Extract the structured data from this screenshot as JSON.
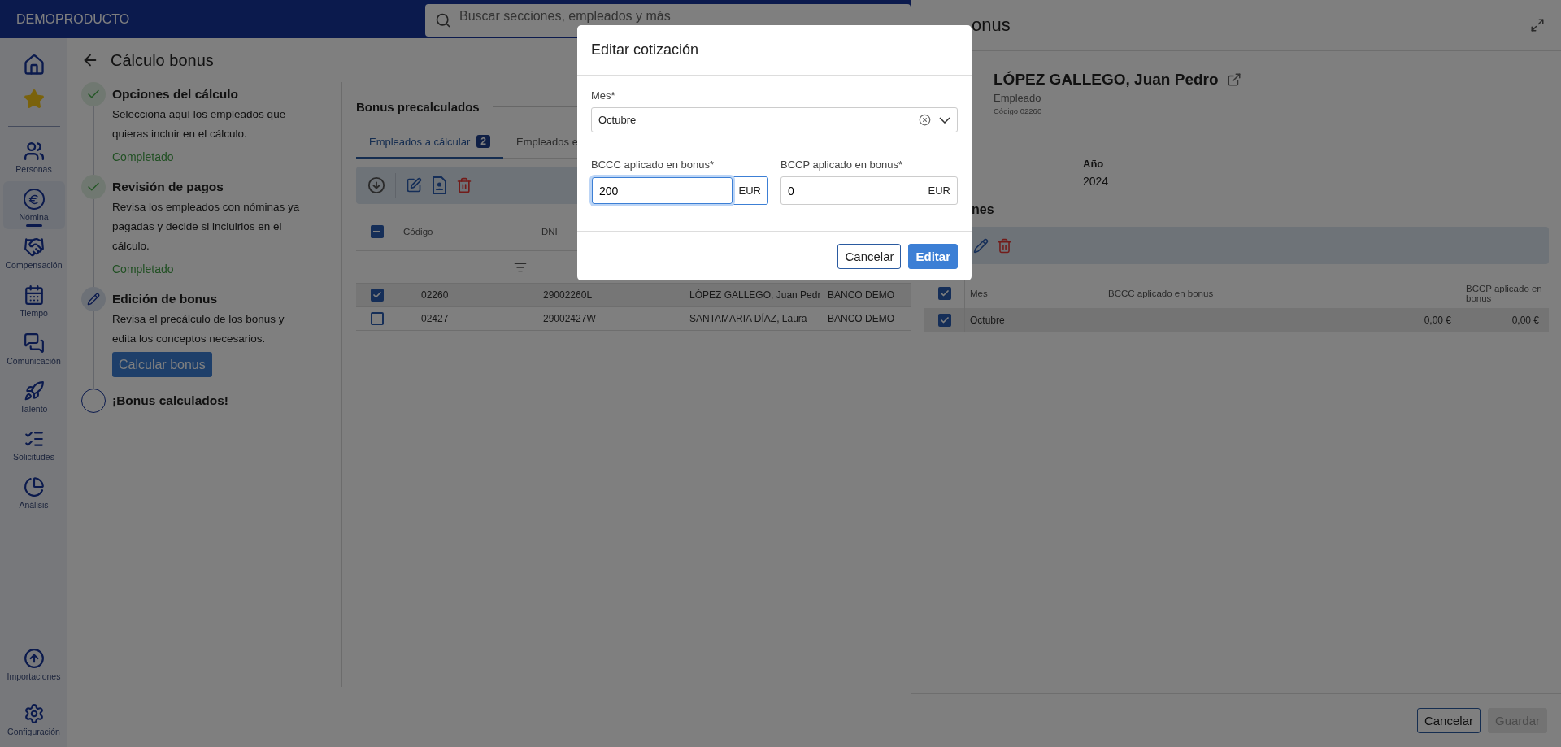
{
  "app": {
    "brand": "DEMOPRODUCTO",
    "search_placeholder": "Buscar secciones, empleados y más"
  },
  "sidebar": {
    "items": [
      {
        "label": "Personas",
        "selected": false
      },
      {
        "label": "Nómina",
        "selected": true
      },
      {
        "label": "Compensación",
        "selected": false
      },
      {
        "label": "Tiempo",
        "selected": false
      },
      {
        "label": "Comunicación",
        "selected": false
      },
      {
        "label": "Talento",
        "selected": false
      },
      {
        "label": "Solicitudes",
        "selected": false
      },
      {
        "label": "Análisis",
        "selected": false
      }
    ],
    "bottom_items": [
      {
        "label": "Importaciones"
      },
      {
        "label": "Configuración"
      }
    ]
  },
  "page": {
    "title": "Cálculo bonus"
  },
  "steps": [
    {
      "title": "Opciones del cálculo",
      "description": "Selecciona aquí los empleados que quieras incluir en el cálculo.",
      "completed": true,
      "current": false,
      "status_text": "Completado"
    },
    {
      "title": "Revisión de pagos",
      "description": "Revisa los empleados con nóminas ya pagadas y decide si incluirlos en el cálculo.",
      "completed": true,
      "current": false,
      "status_text": "Completado"
    },
    {
      "title": "Edición de bonus",
      "description": "Revisa el precálculo de los bonus y edita los conceptos necesarios.",
      "completed": false,
      "current": true,
      "button": "Calcular bonus"
    },
    {
      "title": "¡Bonus calculados!",
      "completed": false,
      "current": false
    }
  ],
  "section": {
    "title": "Bonus precalculados"
  },
  "tabs": [
    {
      "label": "Empleados a cálcular",
      "count": "2",
      "selected": true
    },
    {
      "label": "Empleados e",
      "selected": false
    }
  ],
  "table": {
    "columns": [
      "Código",
      "DNI"
    ],
    "header_indeterminate": true,
    "rows": [
      {
        "cells": [
          "02260",
          "29002260L",
          "LÓPEZ GALLEGO, Juan Pedr",
          "BANCO DEMO"
        ],
        "selected": true
      },
      {
        "cells": [
          "02427",
          "29002427W",
          "SANTAMARIA DÍAZ, Laura",
          "BANCO DEMO"
        ],
        "selected": false
      }
    ]
  },
  "drawer": {
    "title": "onus",
    "employee": {
      "name": "LÓPEZ GALLEGO, Juan Pedro",
      "role": "Empleado",
      "code": "Código 02260"
    },
    "fields": [
      {
        "label": "Año",
        "value": "2024"
      }
    ],
    "section": "nes",
    "table": {
      "columns": [
        "Mes",
        "BCCC aplicado en bonus",
        "BCCP aplicado en bonus"
      ],
      "all_checked": true,
      "rows": [
        {
          "cells": [
            "Octubre",
            "0,00 €",
            "0,00 €"
          ],
          "checked": true
        }
      ]
    },
    "buttons": [
      {
        "label": "Cancelar",
        "kind": "secondary",
        "disabled": false
      },
      {
        "label": "Guardar",
        "kind": "primary",
        "disabled": true
      }
    ]
  },
  "dialog": {
    "title": "Editar cotización",
    "month": {
      "label": "Mes*",
      "value": "Octubre"
    },
    "fields": [
      {
        "label": "BCCC aplicado en bonus*",
        "value": "200",
        "unit": "EUR",
        "focused": true
      },
      {
        "label": "BCCP aplicado en bonus*",
        "value": "0",
        "unit": "EUR",
        "focused": false
      }
    ],
    "buttons": [
      {
        "label": "Cancelar",
        "kind": "secondary"
      },
      {
        "label": "Editar",
        "kind": "primary"
      }
    ]
  }
}
